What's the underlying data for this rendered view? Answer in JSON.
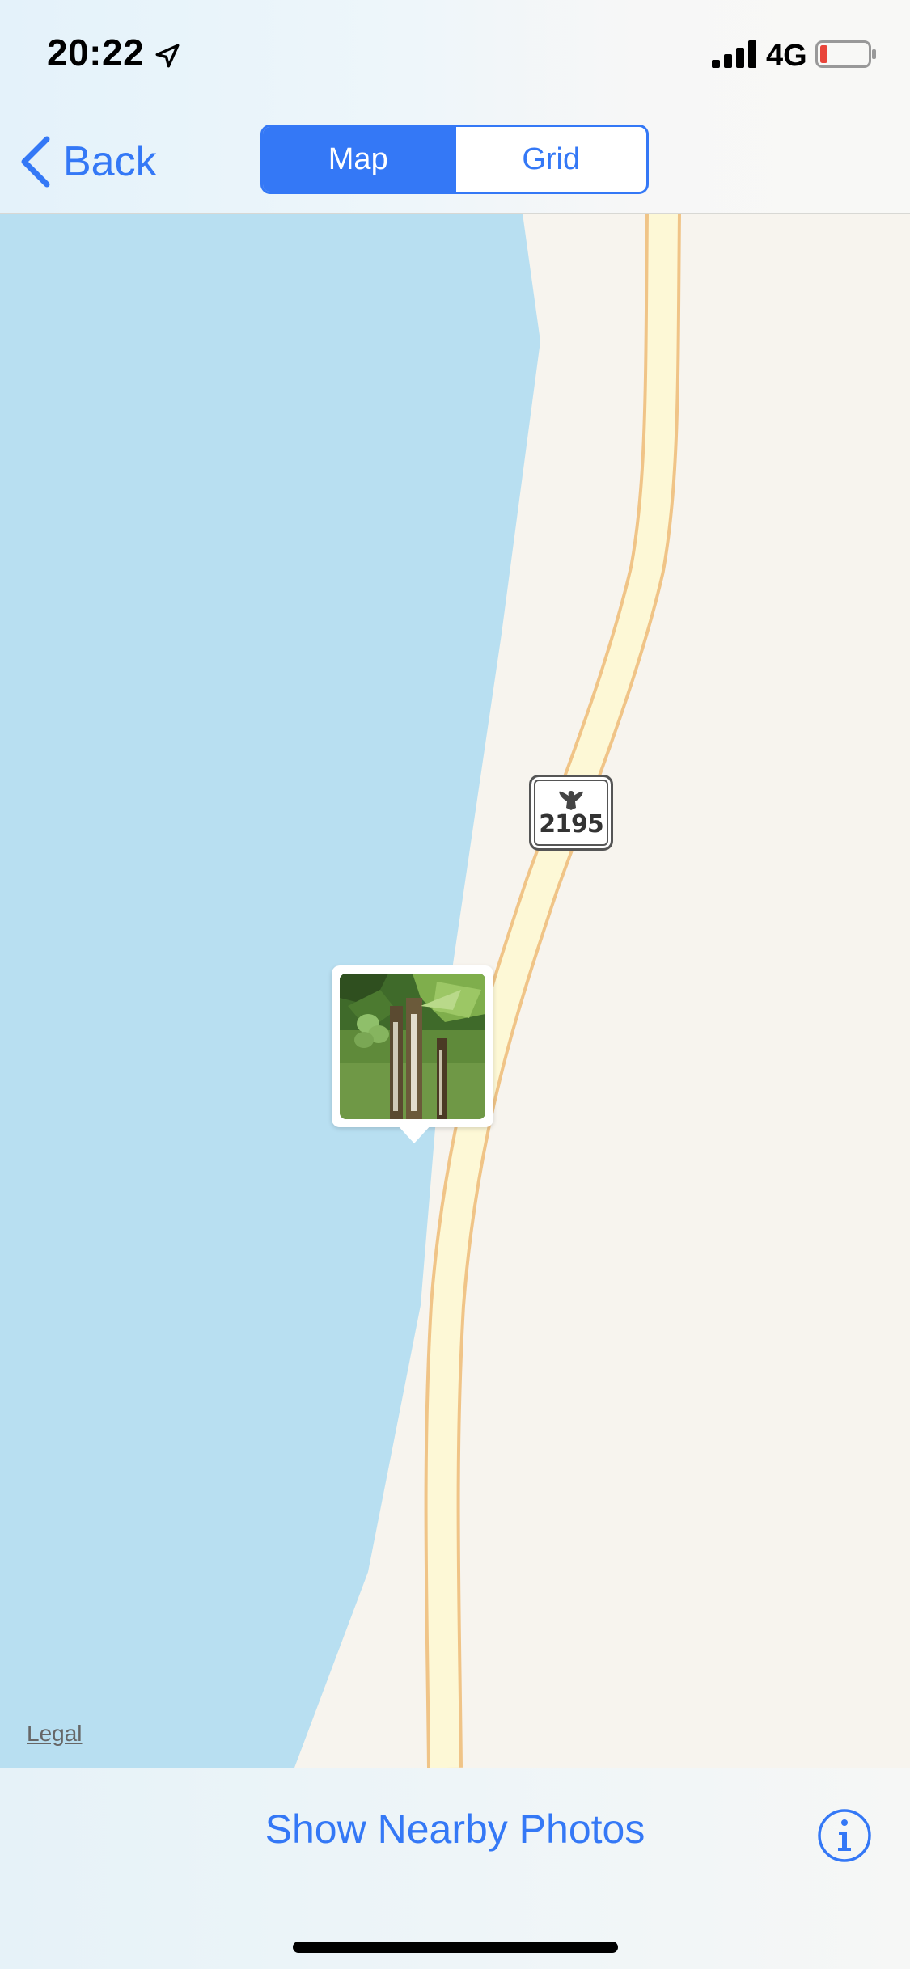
{
  "status_bar": {
    "time": "20:22",
    "network": "4G",
    "icons": [
      "location-arrow-icon",
      "cellular-signal-icon",
      "battery-low-icon"
    ]
  },
  "nav": {
    "back_label": "Back",
    "segments": [
      {
        "label": "Map",
        "selected": true
      },
      {
        "label": "Grid",
        "selected": false
      }
    ]
  },
  "map": {
    "highway_shield": "2195",
    "legal_label": "Legal",
    "photo_annotation": "photo-thumbnail"
  },
  "bottom_bar": {
    "action_label": "Show Nearby Photos",
    "info_icon": "info-icon"
  },
  "colors": {
    "accent": "#3478f6",
    "water": "#b8dff1",
    "land": "#f7f4ee",
    "road_fill": "#fdf8d6",
    "road_edge": "#f0c487",
    "battery_low": "#e9453a"
  }
}
